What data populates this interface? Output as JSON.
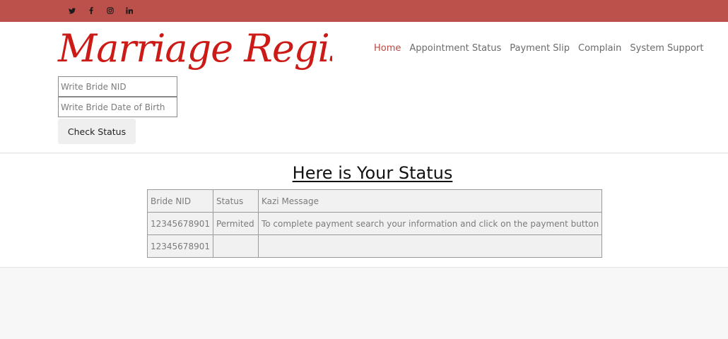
{
  "social": [
    {
      "icon": "twitter-icon"
    },
    {
      "icon": "facebook-icon"
    },
    {
      "icon": "instagram-icon"
    },
    {
      "icon": "linkedin-icon"
    }
  ],
  "brand": {
    "logo_text": "Marriage Register",
    "color": "#cc1a16"
  },
  "colors": {
    "topbar": "#bc514b",
    "nav_active": "#b94a43"
  },
  "nav": {
    "items": [
      {
        "label": "Home",
        "active": true
      },
      {
        "label": "Appointment Status"
      },
      {
        "label": "Payment Slip"
      },
      {
        "label": "Complain"
      },
      {
        "label": "System Support"
      }
    ]
  },
  "form": {
    "nid_placeholder": "Write Bride NID",
    "dob_placeholder": "Write Bride Date of Birth",
    "check_button": "Check Status"
  },
  "status": {
    "title": "Here is Your Status",
    "headers": [
      "Bride NID",
      "Status",
      "Kazi Message"
    ],
    "rows": [
      [
        "12345678901",
        "Permited",
        "To complete payment search your information and click on the payment button"
      ],
      [
        "12345678901",
        "",
        ""
      ]
    ]
  }
}
